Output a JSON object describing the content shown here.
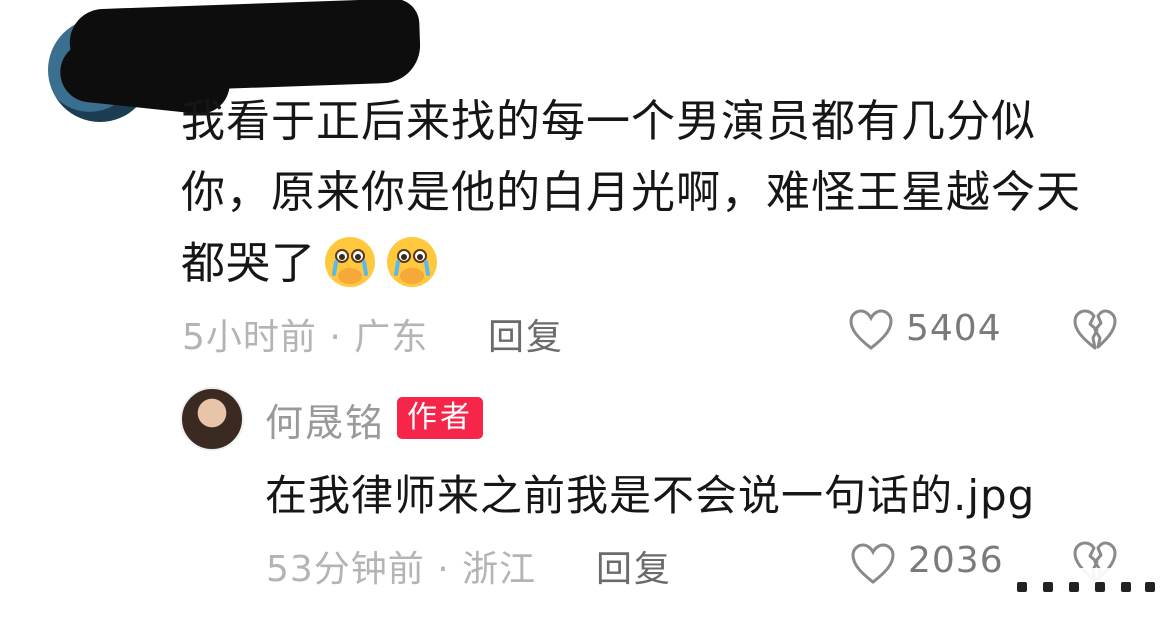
{
  "top_comment": {
    "text_line1": "我看于正后来找的每一个男演员都有几分似",
    "text_line2": "你，原来你是他的白月光啊，难怪王星越今天",
    "text_line3": "都哭了",
    "emojis": [
      "crying-face-icon",
      "crying-face-icon"
    ],
    "meta": "5小时前 · 广东",
    "reply_label": "回复",
    "likes": "5404"
  },
  "reply_comment": {
    "author": "何晟铭",
    "badge": "作者",
    "text": "在我律师来之前我是不会说一句话的.jpg",
    "meta": "53分钟前 · 浙江",
    "reply_label": "回复",
    "likes": "2036"
  },
  "colors": {
    "badge": "#f5264a",
    "meta": "#b4b4b4",
    "text": "#161616"
  }
}
